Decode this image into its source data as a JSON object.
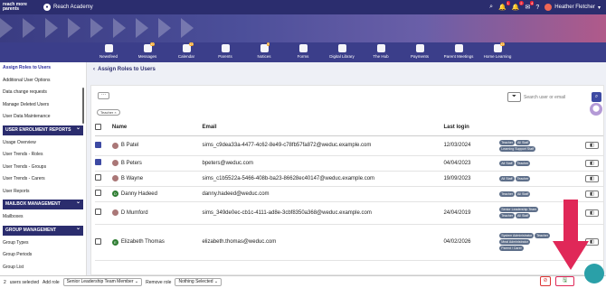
{
  "topbar": {
    "logo": "reach more parents",
    "school": "Reach Academy",
    "badges": [
      "1",
      "2",
      "4"
    ],
    "user_name": "Heather Fletcher"
  },
  "navbar": [
    {
      "label": "Newsfeed",
      "icon": "newsfeed-icon",
      "badge": ""
    },
    {
      "label": "Messages",
      "icon": "messages-icon",
      "badge": "10"
    },
    {
      "label": "Calendar",
      "icon": "calendar-icon",
      "badge": "13"
    },
    {
      "label": "Parents",
      "icon": "parents-icon",
      "badge": ""
    },
    {
      "label": "Notices",
      "icon": "notices-icon",
      "badge": "9"
    },
    {
      "label": "Forms",
      "icon": "forms-icon",
      "badge": ""
    },
    {
      "label": "Digital Library",
      "icon": "library-icon",
      "badge": ""
    },
    {
      "label": "The Hub",
      "icon": "hub-icon",
      "badge": ""
    },
    {
      "label": "Payments",
      "icon": "payments-icon",
      "badge": ""
    },
    {
      "label": "Parent Meetings",
      "icon": "meetings-icon",
      "badge": ""
    },
    {
      "label": "Home Learning",
      "icon": "home-learning-icon",
      "badge": "12"
    }
  ],
  "sidebar": {
    "items_top": [
      "Assign Roles to Users",
      "Additional User Options",
      "Data change requests",
      "Manage Deleted Users",
      "User Data Maintenance"
    ],
    "section1": "USER ENROLMENT REPORTS",
    "items1": [
      "Usage Overview",
      "User Trends - Roles",
      "User Trends - Groups",
      "User Trends - Carers",
      "User Reports"
    ],
    "section2": "MAILBOX MANAGEMENT",
    "items2": [
      "Mailboxes"
    ],
    "section3": "GROUP MANAGEMENT",
    "items3": [
      "Group Types",
      "Group Periods",
      "Group List"
    ]
  },
  "breadcrumb": "Assign Roles to Users",
  "toolbar": {
    "more": "···",
    "filter_chip": "Teacher ×",
    "search_placeholder": "Search user or email"
  },
  "table": {
    "headers": [
      "Name",
      "Email",
      "Last login"
    ],
    "rows": [
      {
        "checked": true,
        "name": "B Patel",
        "email": "sims_c9dea33a-4477-4c62-8e49-c78fb57fa872@weduc.example.com",
        "last_login": "12/03/2024",
        "roles": [
          "Teacher",
          "All Staff",
          "Learning Support Staff"
        ]
      },
      {
        "checked": true,
        "name": "B Peters",
        "email": "bpeters@weduc.com",
        "last_login": "04/04/2023",
        "roles": [
          "All Staff",
          "Teacher"
        ]
      },
      {
        "checked": false,
        "name": "B Wayne",
        "email": "sims_c1b5522a-5466-408b-ba23-86628ec40147@weduc.example.com",
        "last_login": "19/09/2023",
        "roles": [
          "All Staff",
          "Teacher"
        ]
      },
      {
        "checked": false,
        "name": "Danny Hadeed",
        "email": "danny.hadeed@weduc.com",
        "last_login": "",
        "roles": [
          "Teacher",
          "All Staff"
        ]
      },
      {
        "checked": false,
        "name": "D Mumford",
        "email": "sims_349de0ec-cb1c-4111-ad8e-3cbf8350a368@weduc.example.com",
        "last_login": "24/04/2019",
        "roles": [
          "Senior Leadership Team",
          "Teacher",
          "All Staff"
        ]
      },
      {
        "checked": false,
        "name": "Elizabeth Thomas",
        "email": "elizabeth.thomas@weduc.com",
        "last_login": "04/02/2026",
        "roles": [
          "System Administrator",
          "Teacher",
          "Meal Administrator",
          "Parent / Carer"
        ]
      }
    ]
  },
  "bottombar": {
    "selected": "2",
    "selected_text": "users selected",
    "add_role_label": "Add role",
    "add_role_value": "Senior Leadership Team Member",
    "remove_role_label": "Remove role",
    "remove_role_value": "Nothing Selected"
  },
  "colors": {
    "brand": "#2b2d6e",
    "nav": "#3b3e8a",
    "tag": "#5e6f8a",
    "arrow": "#e02858"
  }
}
